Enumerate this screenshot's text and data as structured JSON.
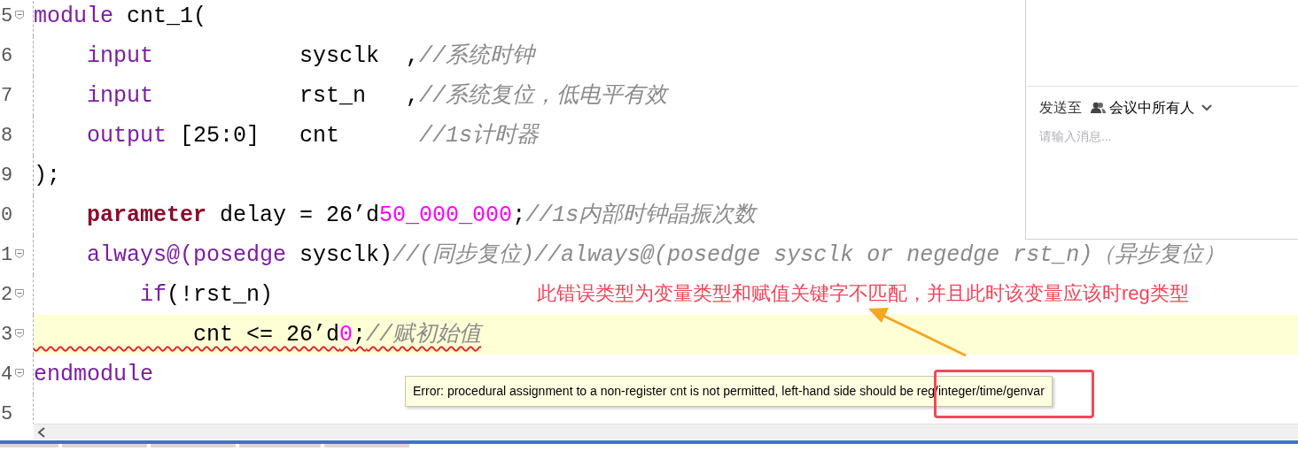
{
  "editor": {
    "lines": [
      {
        "number": "5",
        "fold": true,
        "highlighted": false,
        "error": false,
        "tokens": [
          {
            "kind": "keyword",
            "text": "module"
          },
          {
            "kind": "plain",
            "text": " cnt_1("
          }
        ]
      },
      {
        "number": "6",
        "fold": false,
        "highlighted": false,
        "error": false,
        "tokens": [
          {
            "kind": "keyword",
            "text": "    input"
          },
          {
            "kind": "plain",
            "text": "           sysclk  ,"
          },
          {
            "kind": "comment",
            "text": "//系统时钟"
          }
        ]
      },
      {
        "number": "7",
        "fold": false,
        "highlighted": false,
        "error": false,
        "tokens": [
          {
            "kind": "keyword",
            "text": "    input"
          },
          {
            "kind": "plain",
            "text": "           rst_n   ,"
          },
          {
            "kind": "comment",
            "text": "//系统复位，低电平有效"
          }
        ]
      },
      {
        "number": "8",
        "fold": false,
        "highlighted": false,
        "error": false,
        "tokens": [
          {
            "kind": "keyword",
            "text": "    output"
          },
          {
            "kind": "plain",
            "text": " [25:0]   cnt      "
          },
          {
            "kind": "comment",
            "text": "//1s计时器"
          }
        ]
      },
      {
        "number": "9",
        "fold": false,
        "highlighted": false,
        "error": false,
        "tokens": [
          {
            "kind": "plain",
            "text": ");"
          }
        ]
      },
      {
        "number": "0",
        "fold": false,
        "highlighted": false,
        "error": false,
        "tokens": [
          {
            "kind": "declaration",
            "text": "    parameter"
          },
          {
            "kind": "plain",
            "text": " delay = 26’d"
          },
          {
            "kind": "number",
            "text": "50_000_000"
          },
          {
            "kind": "plain",
            "text": ";"
          },
          {
            "kind": "comment",
            "text": "//1s内部时钟晶振次数"
          }
        ]
      },
      {
        "number": "1",
        "fold": true,
        "highlighted": false,
        "error": false,
        "tokens": [
          {
            "kind": "keyword",
            "text": "    always@(posedge"
          },
          {
            "kind": "plain",
            "text": " sysclk)"
          },
          {
            "kind": "comment",
            "text": "//(同步复位)//always@(posedge sysclk or negedge rst_n)（异步复位）"
          }
        ]
      },
      {
        "number": "2",
        "fold": true,
        "highlighted": false,
        "error": false,
        "tokens": [
          {
            "kind": "keyword",
            "text": "        if"
          },
          {
            "kind": "plain",
            "text": "(!rst_n)"
          }
        ]
      },
      {
        "number": "3",
        "fold": true,
        "highlighted": true,
        "error": true,
        "tokens": [
          {
            "kind": "plain",
            "text": "            cnt <= 26’d"
          },
          {
            "kind": "number",
            "text": "0"
          },
          {
            "kind": "plain",
            "text": ";"
          },
          {
            "kind": "comment",
            "text": "//赋初始值"
          }
        ]
      },
      {
        "number": "4",
        "fold": true,
        "highlighted": false,
        "error": false,
        "tokens": [
          {
            "kind": "keyword",
            "text": "endmodule"
          }
        ]
      },
      {
        "number": "5",
        "fold": false,
        "highlighted": false
      }
    ]
  },
  "error_tooltip": {
    "text": "Error: procedural assignment to a non-register cnt is not permitted, left-hand side should be reg/integer/time/genvar"
  },
  "annotation": {
    "text": "此错误类型为变量类型和赋值关键字不匹配，并且此时该变量应该时reg类型"
  },
  "chat_panel": {
    "send_to_label": "发送至",
    "recipient": "会议中所有人",
    "message_field": {
      "placeholder": "请输入消息..."
    }
  }
}
